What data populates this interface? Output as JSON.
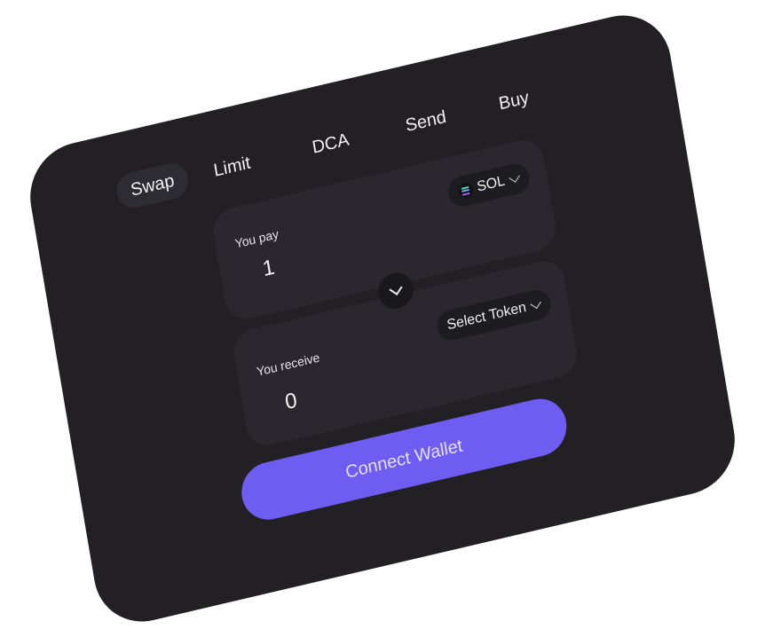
{
  "tabs": [
    {
      "label": "Swap",
      "active": true
    },
    {
      "label": "Limit",
      "active": false
    },
    {
      "label": "DCA",
      "active": false
    },
    {
      "label": "Send",
      "active": false
    },
    {
      "label": "Buy",
      "active": false
    }
  ],
  "pay": {
    "label": "You pay",
    "amount": "1",
    "token": "SOL",
    "token_icon": "solana-logo-icon"
  },
  "receive": {
    "label": "You receive",
    "amount": "0",
    "token": "Select Token"
  },
  "swap_toggle_icon": "chevron-down-icon",
  "connect_button": "Connect Wallet",
  "colors": {
    "card_bg": "#222025",
    "panel_bg": "#2a282e",
    "accent": "#6f5cf0",
    "sol_gradient": [
      "#14f195",
      "#9945ff"
    ]
  }
}
